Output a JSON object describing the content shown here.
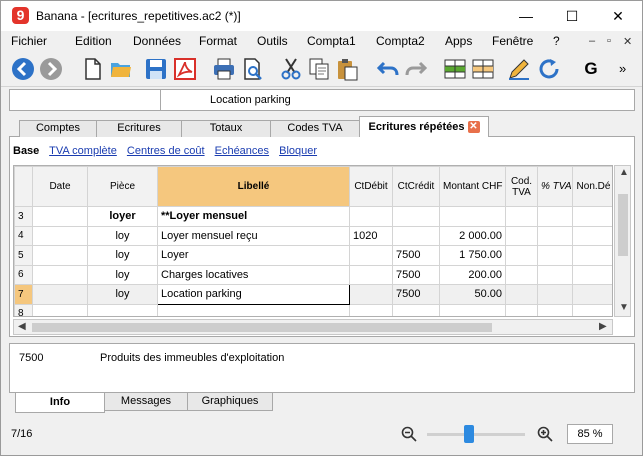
{
  "window": {
    "title": "Banana - [ecritures_repetitives.ac2 (*)]",
    "logo_letter": "9",
    "minimize": "—",
    "maximize": "☐",
    "close": "✕"
  },
  "menu": {
    "items": [
      "Fichier",
      "Edition",
      "Données",
      "Format",
      "Outils",
      "Compta1",
      "Compta2",
      "Apps",
      "Fenêtre",
      "?"
    ],
    "mdi_controls": [
      "–",
      "▫",
      "✕"
    ]
  },
  "toolbar": {
    "icons": [
      "back-icon",
      "forward-icon",
      "new-file-icon",
      "open-folder-icon",
      "save-icon",
      "pdf-icon",
      "print-icon",
      "print-preview-icon",
      "cut-icon",
      "copy-icon",
      "paste-icon",
      "undo-icon",
      "redo-icon",
      "insert-row-icon",
      "delete-row-icon",
      "edit-icon",
      "refresh-icon",
      "bold-icon",
      "more-icon"
    ],
    "bold_label": "G",
    "more_label": "»"
  },
  "cellbar": {
    "address": "",
    "content": "Location parking"
  },
  "tabs": [
    {
      "label": "Comptes"
    },
    {
      "label": "Ecritures"
    },
    {
      "label": "Totaux"
    },
    {
      "label": "Codes TVA"
    },
    {
      "label": "Ecritures répétées",
      "active": true
    }
  ],
  "views": {
    "current": "Base",
    "links": [
      "TVA complète",
      "Centres de coût",
      "Echéances",
      "Bloquer"
    ]
  },
  "table": {
    "columns": [
      "Date",
      "Pièce",
      "Libellé",
      "CtDébit",
      "CtCrédit",
      "Montant CHF",
      "Cod. TVA",
      "% TVA",
      "Non.Dé"
    ],
    "rows": [
      {
        "num": "3",
        "date": "",
        "piece": "loyer",
        "libelle": "**Loyer mensuel",
        "debit": "",
        "credit": "",
        "montant": "",
        "bold": true
      },
      {
        "num": "4",
        "date": "",
        "piece": "loy",
        "libelle": "Loyer mensuel reçu",
        "debit": "1020",
        "credit": "",
        "montant": "2 000.00"
      },
      {
        "num": "5",
        "date": "",
        "piece": "loy",
        "libelle": "Loyer",
        "debit": "",
        "credit": "7500",
        "montant": "1 750.00"
      },
      {
        "num": "6",
        "date": "",
        "piece": "loy",
        "libelle": "Charges locatives",
        "debit": "",
        "credit": "7500",
        "montant": "200.00"
      },
      {
        "num": "7",
        "date": "",
        "piece": "loy",
        "libelle": "Location parking",
        "debit": "",
        "credit": "7500",
        "montant": "50.00",
        "current": true
      },
      {
        "num": "8",
        "date": "",
        "piece": "",
        "libelle": "",
        "debit": "",
        "credit": "",
        "montant": ""
      }
    ]
  },
  "info": {
    "account": "7500",
    "description": "Produits des immeubles d'exploitation"
  },
  "bottom_tabs": [
    {
      "label": "Info",
      "active": true
    },
    {
      "label": "Messages"
    },
    {
      "label": "Graphiques"
    }
  ],
  "status": {
    "position": "7/16",
    "zoom": "85 %",
    "zoom_level": 0.85
  },
  "colors": {
    "header_selected": "#f5c77e",
    "link": "#1a3cb0",
    "tab_close": "#e8704a",
    "nav_blue": "#2d72c7",
    "slider_blue": "#2d8ae0"
  }
}
